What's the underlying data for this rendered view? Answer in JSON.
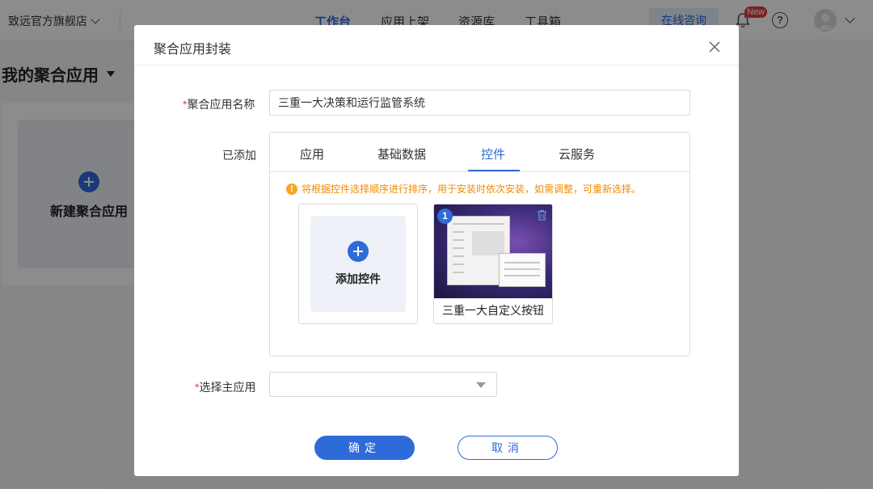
{
  "topbar": {
    "store_name": "致远官方旗舰店",
    "nav": [
      {
        "label": "工作台",
        "active": true
      },
      {
        "label": "应用上架",
        "active": false
      },
      {
        "label": "资源库",
        "active": false
      },
      {
        "label": "工具箱",
        "active": false
      }
    ],
    "consult_label": "在线咨询",
    "new_badge": "New",
    "help_glyph": "?"
  },
  "background": {
    "page_title": "我的聚合应用",
    "new_card_label": "新建聚合应用"
  },
  "modal": {
    "title": "聚合应用封装",
    "close_icon": "close-icon",
    "name_field": {
      "required_mark": "*",
      "label": "聚合应用名称",
      "value": "三重一大决策和运行监管系统"
    },
    "added": {
      "label": "已添加",
      "tabs": [
        {
          "label": "应用",
          "active": false
        },
        {
          "label": "基础数据",
          "active": false
        },
        {
          "label": "控件",
          "active": true
        },
        {
          "label": "云服务",
          "active": false
        }
      ],
      "hint_icon": "!",
      "hint": "将根据控件选择顺序进行排序，用于安装时依次安装，如需调整，可重新选择。",
      "add_control_label": "添加控件",
      "controls": [
        {
          "order": "1",
          "name": "三重一大自定义按钮"
        }
      ]
    },
    "main_app": {
      "required_mark": "*",
      "label": "选择主应用",
      "value": ""
    },
    "confirm_label": "确定",
    "cancel_label": "取消"
  },
  "colors": {
    "accent": "#2f6bd8",
    "warning": "#f08c00",
    "required": "#e23c3c"
  }
}
